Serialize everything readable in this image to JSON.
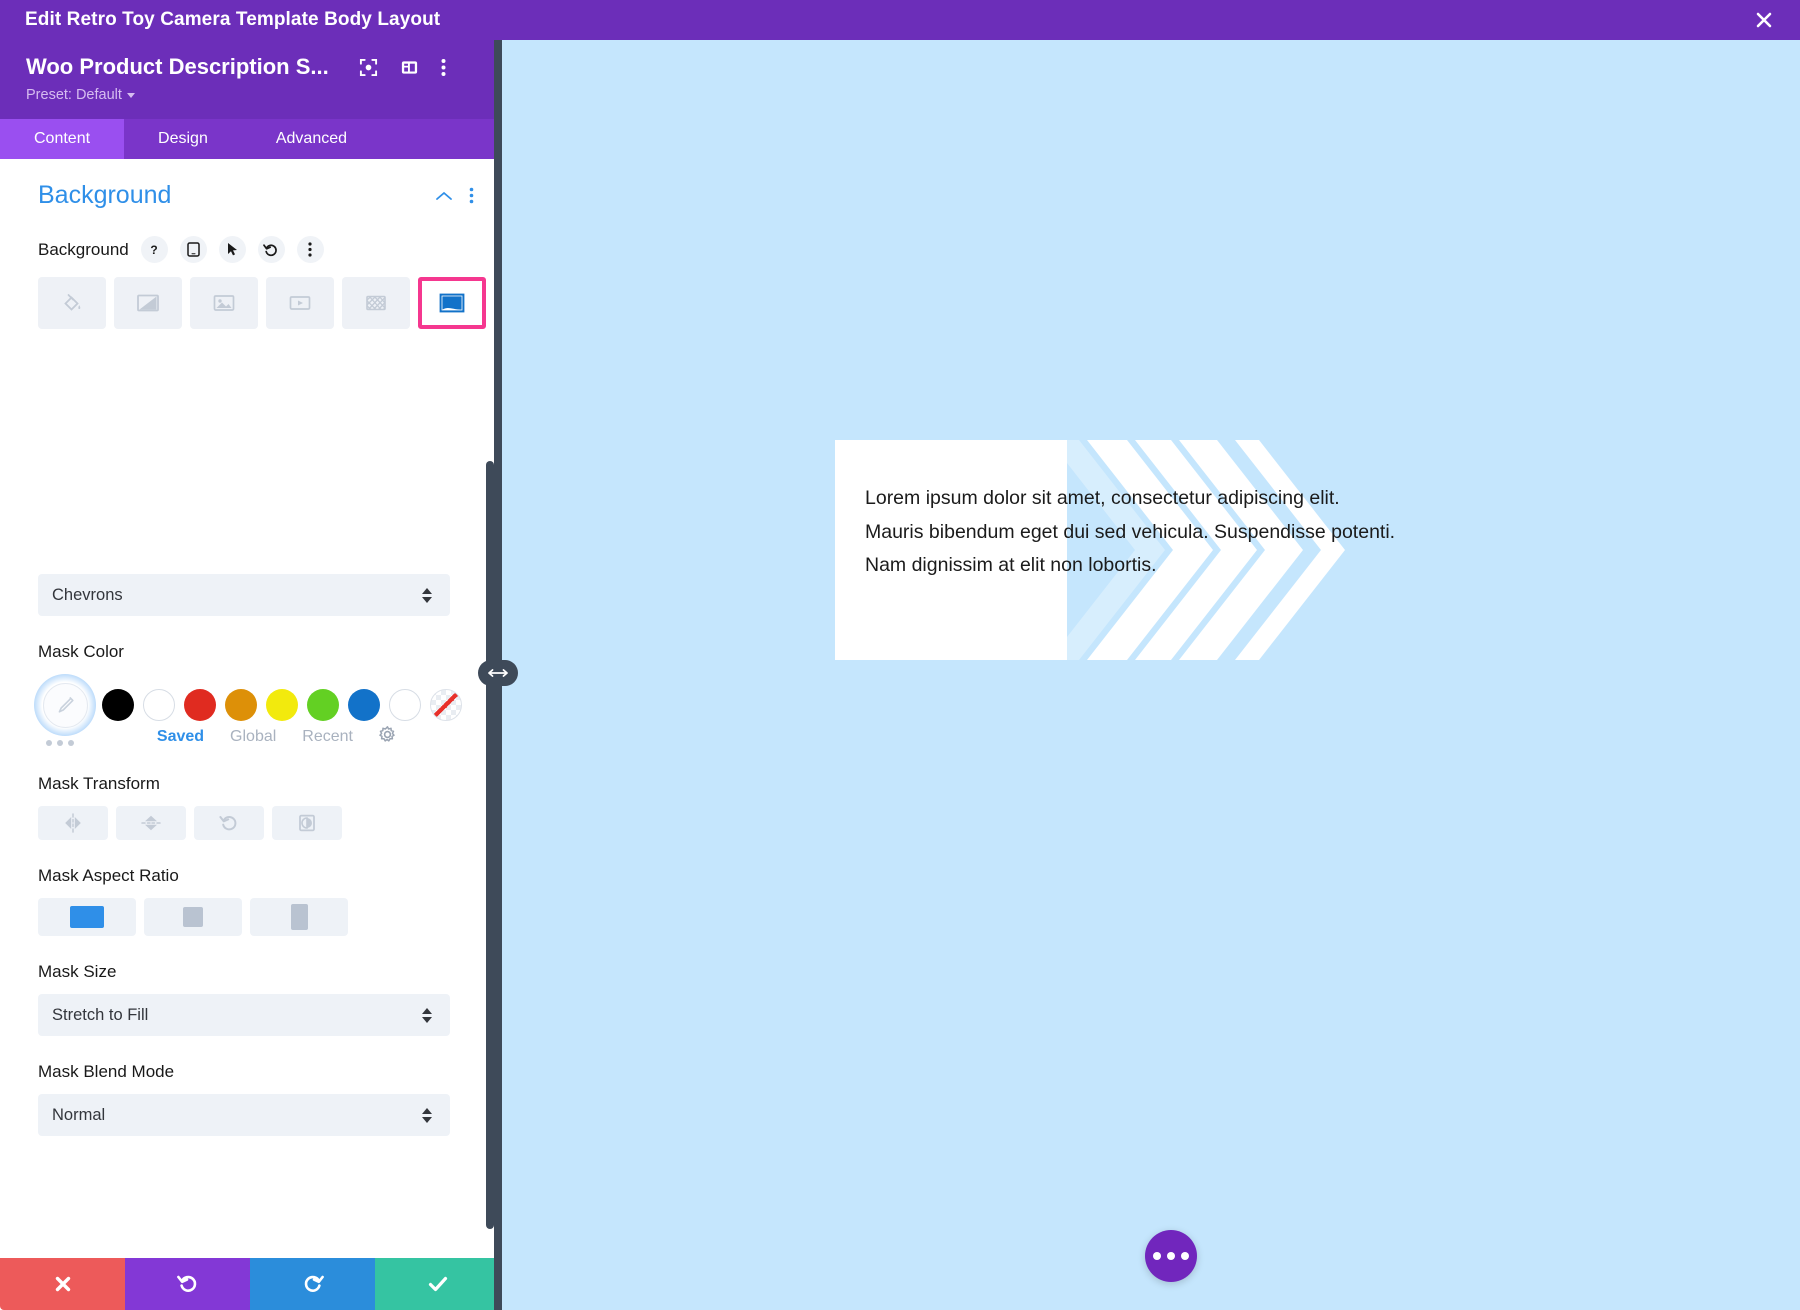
{
  "topbar": {
    "title": "Edit Retro Toy Camera Template Body Layout",
    "close_icon": "close-icon"
  },
  "panel": {
    "module_name": "Woo Product Description S...",
    "preset_label": "Preset: Default",
    "header_icons": [
      "focus-icon",
      "layout-panel-icon",
      "kebab-menu-icon"
    ],
    "tabs": [
      {
        "label": "Content",
        "active": true
      },
      {
        "label": "Design",
        "active": false
      },
      {
        "label": "Advanced",
        "active": false
      }
    ],
    "section": {
      "title": "Background",
      "collapse_icon": "chevron-up-icon",
      "more_icon": "kebab-menu-icon"
    },
    "background_field": {
      "label": "Background",
      "controls": [
        "help-icon",
        "responsive-mobile-icon",
        "hover-cursor-icon",
        "reset-undo-icon",
        "kebab-menu-icon"
      ],
      "types": [
        {
          "name": "color-fill",
          "selected": false
        },
        {
          "name": "gradient",
          "selected": false
        },
        {
          "name": "image",
          "selected": false
        },
        {
          "name": "video",
          "selected": false
        },
        {
          "name": "pattern",
          "selected": false
        },
        {
          "name": "mask",
          "selected": true
        }
      ],
      "selected_highlight_color": "#f5378f"
    },
    "mask_pattern": {
      "value": "Chevrons"
    },
    "mask_color": {
      "label": "Mask Color",
      "eyedropper_selected": true,
      "swatches": [
        {
          "name": "black",
          "hex": "#000000"
        },
        {
          "name": "white",
          "hex": "#ffffff"
        },
        {
          "name": "red",
          "hex": "#e02b20"
        },
        {
          "name": "orange",
          "hex": "#dd9008"
        },
        {
          "name": "yellow",
          "hex": "#f2ea0d"
        },
        {
          "name": "green",
          "hex": "#63d023"
        },
        {
          "name": "blue",
          "hex": "#1272c9"
        },
        {
          "name": "white-outline",
          "hex": "#ffffff"
        },
        {
          "name": "transparent",
          "hex": "transparent"
        }
      ],
      "palette_tabs": [
        {
          "label": "Saved",
          "active": true
        },
        {
          "label": "Global",
          "active": false
        },
        {
          "label": "Recent",
          "active": false
        }
      ],
      "settings_icon": "gear-icon"
    },
    "mask_transform": {
      "label": "Mask Transform",
      "buttons": [
        "flip-horizontal-icon",
        "flip-vertical-icon",
        "rotate-icon",
        "invert-icon"
      ]
    },
    "mask_aspect_ratio": {
      "label": "Mask Aspect Ratio",
      "options": [
        {
          "name": "landscape",
          "selected": true
        },
        {
          "name": "square",
          "selected": false
        },
        {
          "name": "portrait",
          "selected": false
        }
      ]
    },
    "mask_size": {
      "label": "Mask Size",
      "value": "Stretch to Fill"
    },
    "mask_blend_mode": {
      "label": "Mask Blend Mode",
      "value": "Normal"
    },
    "actions": [
      {
        "name": "discard",
        "icon": "x-icon",
        "color": "#ed5a5a"
      },
      {
        "name": "undo",
        "icon": "undo-icon",
        "color": "#8338d6"
      },
      {
        "name": "redo",
        "icon": "redo-icon",
        "color": "#2b8ddb"
      },
      {
        "name": "save",
        "icon": "check-icon",
        "color": "#35c4a2"
      }
    ]
  },
  "canvas": {
    "background_color": "#c5e6fd",
    "module_text": "Lorem ipsum dolor sit amet, consectetur adipiscing elit. Mauris bibendum eget dui sed vehicula. Suspendisse potenti. Nam dignissim at elit non lobortis.",
    "mask_shape": "chevrons",
    "mask_fill": "#ffffff",
    "fab_icon": "more-options-icon"
  }
}
